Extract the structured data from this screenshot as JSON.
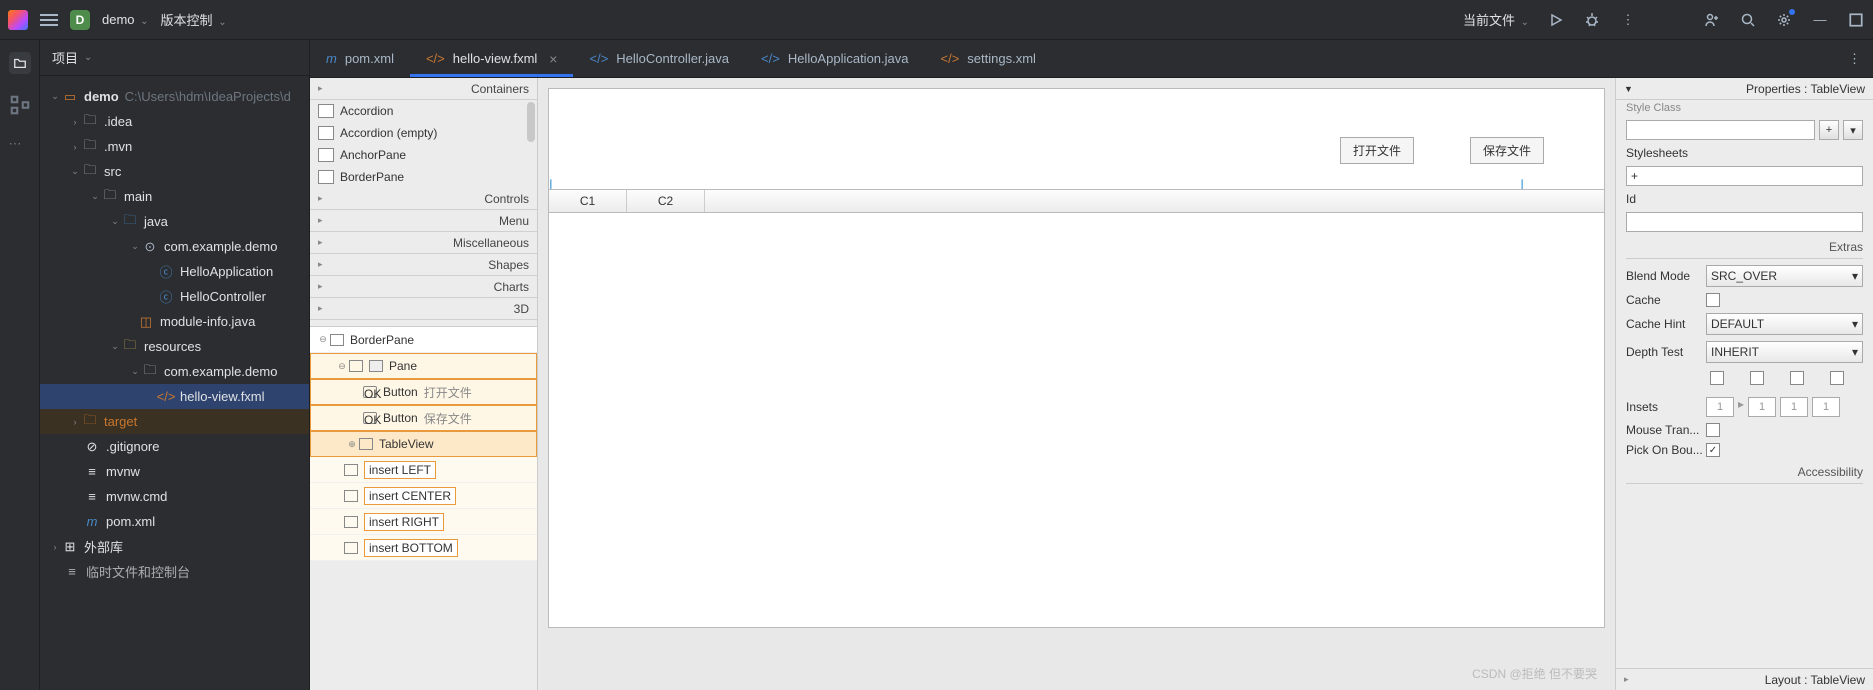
{
  "titlebar": {
    "project_badge": "D",
    "project_name": "demo",
    "vcs_menu": "版本控制",
    "run_config": "当前文件"
  },
  "sidebar": {
    "title": "项目",
    "root": "demo",
    "root_path": "C:\\Users\\hdm\\IdeaProjects\\d",
    "nodes": {
      "idea": ".idea",
      "mvn": ".mvn",
      "src": "src",
      "main": "main",
      "java": "java",
      "pkg": "com.example.demo",
      "app": "HelloApplication",
      "ctrl": "HelloController",
      "module": "module-info.java",
      "resources": "resources",
      "respkg": "com.example.demo",
      "fxml": "hello-view.fxml",
      "target": "target",
      "gitignore": ".gitignore",
      "mvnw": "mvnw",
      "mvnwcmd": "mvnw.cmd",
      "pom": "pom.xml",
      "extlib": "外部库",
      "scratch": "临时文件和控制台"
    }
  },
  "tabs": [
    {
      "icon": "m",
      "label": "pom.xml"
    },
    {
      "icon": "code",
      "label": "hello-view.fxml",
      "active": true,
      "closable": true
    },
    {
      "icon": "code",
      "label": "HelloController.java"
    },
    {
      "icon": "code",
      "label": "HelloApplication.java"
    },
    {
      "icon": "code",
      "label": "settings.xml"
    }
  ],
  "palette": {
    "sections": [
      "Containers",
      "Controls",
      "Menu",
      "Miscellaneous",
      "Shapes",
      "Charts",
      "3D"
    ],
    "containers": [
      "Accordion",
      "Accordion  (empty)",
      "AnchorPane",
      "BorderPane"
    ]
  },
  "hierarchy": {
    "root": "BorderPane",
    "pane": "Pane",
    "btn1": {
      "type": "Button",
      "text": "打开文件"
    },
    "btn2": {
      "type": "Button",
      "text": "保存文件"
    },
    "table": "TableView",
    "hints": [
      "insert LEFT",
      "insert CENTER",
      "insert RIGHT",
      "insert BOTTOM"
    ]
  },
  "canvas": {
    "btn_open": "打开文件",
    "btn_save": "保存文件",
    "col1": "C1",
    "col2": "C2"
  },
  "props": {
    "title": "Properties : TableView",
    "style_class": "Style Class",
    "stylesheets": "Stylesheets",
    "add": "+",
    "id": "Id",
    "extras": "Extras",
    "blend_mode": {
      "label": "Blend Mode",
      "value": "SRC_OVER"
    },
    "cache": "Cache",
    "cache_hint": {
      "label": "Cache Hint",
      "value": "DEFAULT"
    },
    "depth_test": {
      "label": "Depth Test",
      "value": "INHERIT"
    },
    "insets": {
      "label": "Insets",
      "v": "1"
    },
    "mouse": "Mouse Tran...",
    "pick": "Pick On Bou...",
    "accessibility": "Accessibility",
    "layout": "Layout : TableView"
  },
  "watermark": "CSDN @拒绝 但不要哭"
}
